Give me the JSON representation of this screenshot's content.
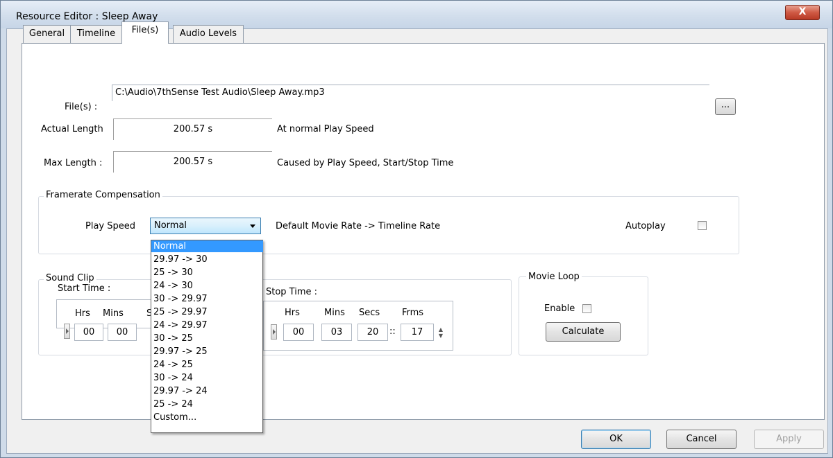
{
  "window": {
    "title": "Resource Editor : Sleep Away",
    "close_symbol": "X"
  },
  "tabs": [
    {
      "label": "General"
    },
    {
      "label": "Timeline"
    },
    {
      "label": "File(s)"
    },
    {
      "label": "Audio Levels"
    }
  ],
  "files": {
    "label": "File(s) :",
    "path": "C:\\Audio\\7thSense Test Audio\\Sleep Away.mp3",
    "browse_label": "..."
  },
  "actual_length": {
    "label": "Actual Length",
    "value": "200.57 s",
    "note": "At normal Play Speed"
  },
  "max_length": {
    "label": "Max Length :",
    "value": "200.57 s",
    "note": "Caused by Play Speed, Start/Stop Time"
  },
  "framerate": {
    "group_label": "Framerate Compensation",
    "play_speed_label": "Play Speed",
    "play_speed_value": "Normal",
    "description": "Default Movie Rate -> Timeline Rate",
    "autoplay_label": "Autoplay",
    "autoplay_checked": false,
    "options": [
      "Normal",
      "29.97 -> 30",
      "25 -> 30",
      "24 -> 30",
      "30 -> 29.97",
      "25 -> 29.97",
      "24 -> 29.97",
      "30 -> 25",
      "29.97 -> 25",
      "24 -> 25",
      "30 -> 24",
      "29.97 -> 24",
      "25 -> 24",
      "Custom..."
    ]
  },
  "sound_clip": {
    "group_label": "Sound Clip",
    "start_label": "Start Time :",
    "start_headers": {
      "hrs": "Hrs",
      "mins": "Mins",
      "secs_partial": "S"
    },
    "start_values": {
      "hrs": "00",
      "mins": "00"
    },
    "stop_label": "Stop Time :",
    "stop_headers": {
      "hrs": "Hrs",
      "mins": "Mins",
      "secs": "Secs",
      "frms": "Frms"
    },
    "stop_values": {
      "hrs": "00",
      "mins": "03",
      "secs": "20",
      "sep": "::",
      "frms": "17"
    }
  },
  "movie_loop": {
    "group_label": "Movie Loop",
    "enable_label": "Enable",
    "enable_checked": false,
    "calculate_label": "Calculate"
  },
  "buttons": {
    "ok": "OK",
    "cancel": "Cancel",
    "apply": "Apply"
  }
}
